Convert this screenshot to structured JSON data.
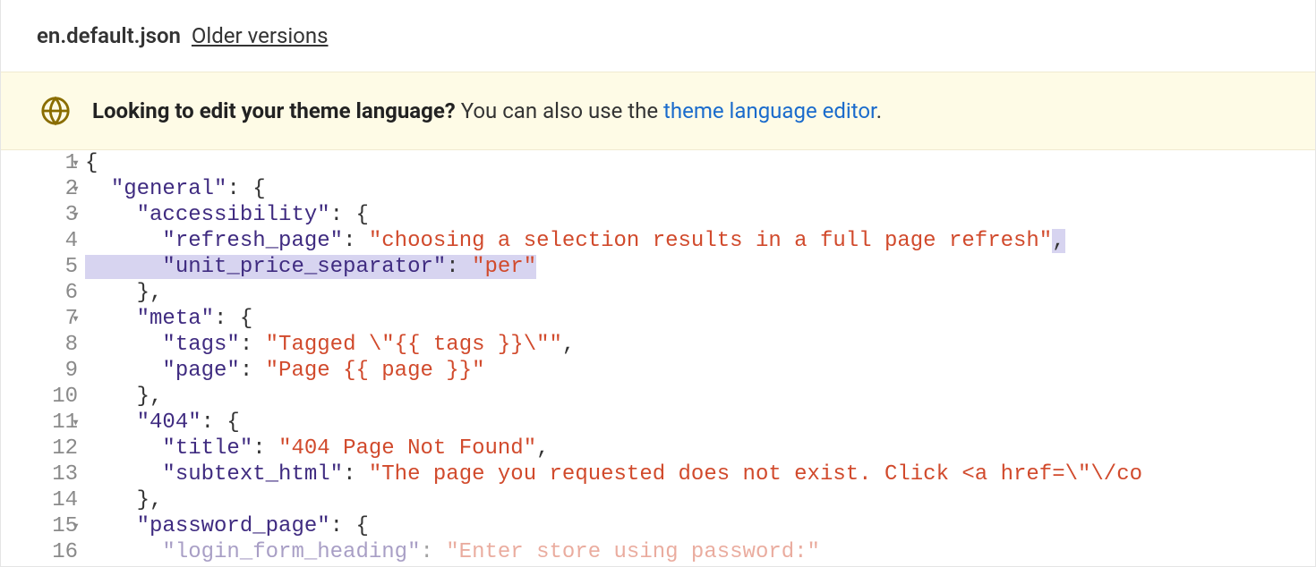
{
  "header": {
    "filename": "en.default.json",
    "older_versions": "Older versions"
  },
  "banner": {
    "strong": "Looking to edit your theme language?",
    "regular": "You can also use the",
    "link": "theme language editor",
    "period": "."
  },
  "code": {
    "lines": [
      {
        "num": "1",
        "fold": true,
        "seg": [
          {
            "c": "p",
            "t": "{"
          }
        ]
      },
      {
        "num": "2",
        "fold": true,
        "seg": [
          {
            "c": "p",
            "t": "  "
          },
          {
            "c": "k",
            "t": "\"general\""
          },
          {
            "c": "p",
            "t": ": {"
          }
        ]
      },
      {
        "num": "3",
        "fold": true,
        "seg": [
          {
            "c": "p",
            "t": "    "
          },
          {
            "c": "k",
            "t": "\"accessibility\""
          },
          {
            "c": "p",
            "t": ": {"
          }
        ]
      },
      {
        "num": "4",
        "hlTrail": true,
        "seg": [
          {
            "c": "p",
            "t": "      "
          },
          {
            "c": "k",
            "t": "\"refresh_page\""
          },
          {
            "c": "p",
            "t": ": "
          },
          {
            "c": "s",
            "t": "\"choosing a selection results in a full page refresh\""
          },
          {
            "c": "p",
            "t": ","
          }
        ]
      },
      {
        "num": "5",
        "hlFull": true,
        "seg": [
          {
            "c": "p",
            "t": "      "
          },
          {
            "c": "k",
            "t": "\"unit_price_separator\""
          },
          {
            "c": "p",
            "t": ": "
          },
          {
            "c": "s",
            "t": "\"per\""
          }
        ]
      },
      {
        "num": "6",
        "seg": [
          {
            "c": "p",
            "t": "    },"
          }
        ]
      },
      {
        "num": "7",
        "fold": true,
        "seg": [
          {
            "c": "p",
            "t": "    "
          },
          {
            "c": "k",
            "t": "\"meta\""
          },
          {
            "c": "p",
            "t": ": {"
          }
        ]
      },
      {
        "num": "8",
        "seg": [
          {
            "c": "p",
            "t": "      "
          },
          {
            "c": "k",
            "t": "\"tags\""
          },
          {
            "c": "p",
            "t": ": "
          },
          {
            "c": "s",
            "t": "\"Tagged \\\"{{ tags }}\\\"\""
          },
          {
            "c": "p",
            "t": ","
          }
        ]
      },
      {
        "num": "9",
        "seg": [
          {
            "c": "p",
            "t": "      "
          },
          {
            "c": "k",
            "t": "\"page\""
          },
          {
            "c": "p",
            "t": ": "
          },
          {
            "c": "s",
            "t": "\"Page {{ page }}\""
          }
        ]
      },
      {
        "num": "10",
        "seg": [
          {
            "c": "p",
            "t": "    },"
          }
        ]
      },
      {
        "num": "11",
        "fold": true,
        "seg": [
          {
            "c": "p",
            "t": "    "
          },
          {
            "c": "k",
            "t": "\"404\""
          },
          {
            "c": "p",
            "t": ": {"
          }
        ]
      },
      {
        "num": "12",
        "seg": [
          {
            "c": "p",
            "t": "      "
          },
          {
            "c": "k",
            "t": "\"title\""
          },
          {
            "c": "p",
            "t": ": "
          },
          {
            "c": "s",
            "t": "\"404 Page Not Found\""
          },
          {
            "c": "p",
            "t": ","
          }
        ]
      },
      {
        "num": "13",
        "seg": [
          {
            "c": "p",
            "t": "      "
          },
          {
            "c": "k",
            "t": "\"subtext_html\""
          },
          {
            "c": "p",
            "t": ": "
          },
          {
            "c": "s",
            "t": "\"The page you requested does not exist. Click <a href=\\\"\\/co"
          }
        ]
      },
      {
        "num": "14",
        "seg": [
          {
            "c": "p",
            "t": "    },"
          }
        ]
      },
      {
        "num": "15",
        "fold": true,
        "seg": [
          {
            "c": "p",
            "t": "    "
          },
          {
            "c": "k",
            "t": "\"password_page\""
          },
          {
            "c": "p",
            "t": ": {"
          }
        ]
      },
      {
        "num": "16",
        "fade": true,
        "seg": [
          {
            "c": "p",
            "t": "      "
          },
          {
            "c": "k",
            "t": "\"login_form_heading\""
          },
          {
            "c": "p",
            "t": ": "
          },
          {
            "c": "s",
            "t": "\"Enter store using password:\""
          }
        ]
      }
    ]
  }
}
